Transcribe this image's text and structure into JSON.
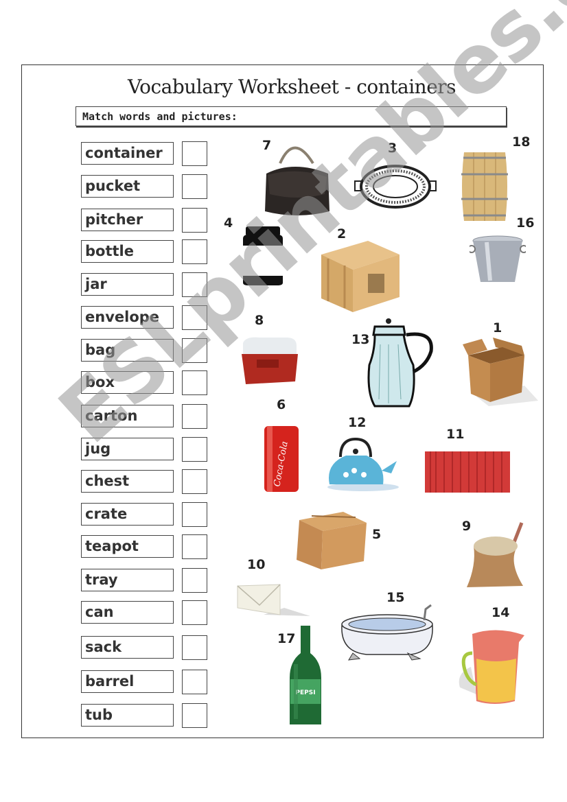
{
  "title": "Vocabulary Worksheet - containers",
  "instruction": "Match words and pictures:",
  "words": [
    "container",
    "pucket",
    "pitcher",
    "bottle",
    "jar",
    "envelope",
    "bag",
    "box",
    "carton",
    "jug",
    "chest",
    "crate",
    "teapot",
    "tray",
    "can",
    "sack",
    "barrel",
    "tub"
  ],
  "pictures": [
    {
      "number": "7",
      "item": "bag-icon"
    },
    {
      "number": "3",
      "item": "tray-icon"
    },
    {
      "number": "18",
      "item": "barrel-icon"
    },
    {
      "number": "4",
      "item": "jar-icon"
    },
    {
      "number": "2",
      "item": "crate-icon"
    },
    {
      "number": "16",
      "item": "bucket-icon"
    },
    {
      "number": "8",
      "item": "cooler-chest-icon"
    },
    {
      "number": "13",
      "item": "pitcher-icon"
    },
    {
      "number": "1",
      "item": "open-box-icon"
    },
    {
      "number": "6",
      "item": "soda-can-icon"
    },
    {
      "number": "12",
      "item": "teapot-icon"
    },
    {
      "number": "11",
      "item": "shipping-container-icon"
    },
    {
      "number": "5",
      "item": "carton-icon"
    },
    {
      "number": "9",
      "item": "sack-icon"
    },
    {
      "number": "10",
      "item": "envelope-icon"
    },
    {
      "number": "15",
      "item": "bathtub-icon"
    },
    {
      "number": "14",
      "item": "jug-icon"
    },
    {
      "number": "17",
      "item": "bottle-icon"
    }
  ],
  "watermark": "ESLprintables.com"
}
